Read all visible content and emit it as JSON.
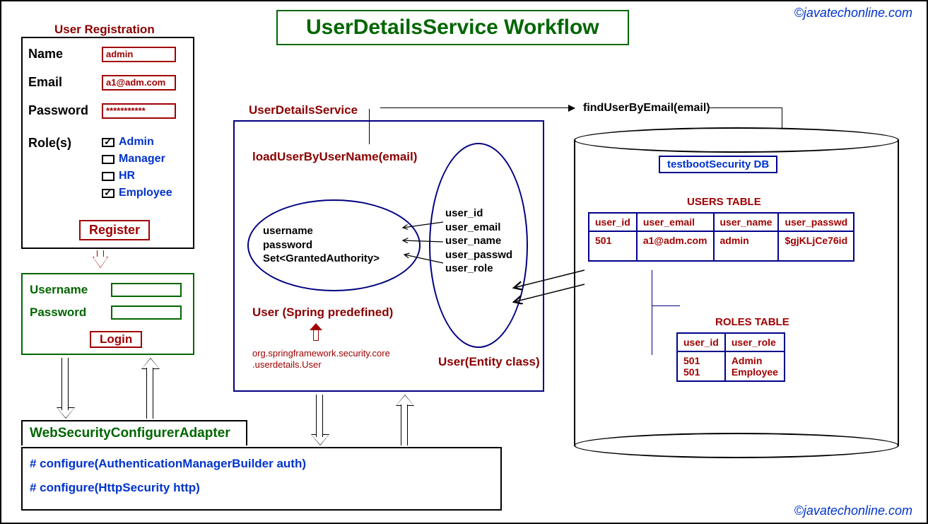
{
  "title": "UserDetailsService Workflow",
  "watermark": "©javatechonline.com",
  "registration": {
    "heading": "User Registration",
    "name_label": "Name",
    "name_value": "admin",
    "email_label": "Email",
    "email_value": "a1@adm.com",
    "password_label": "Password",
    "password_value": "***********",
    "roles_label": "Role(s)",
    "roles": [
      {
        "label": "Admin",
        "checked": true
      },
      {
        "label": "Manager",
        "checked": false
      },
      {
        "label": "HR",
        "checked": false
      },
      {
        "label": "Employee",
        "checked": true
      }
    ],
    "button": "Register"
  },
  "login": {
    "username_label": "Username",
    "password_label": "Password",
    "button": "Login"
  },
  "uds": {
    "title": "UserDetailsService",
    "method": "loadUserByUserName(email)",
    "spring_user_fields": "username\npassword\nSet<GrantedAuthority>",
    "entity_fields": "user_id\nuser_email\nuser_name\nuser_passwd\nuser_role",
    "spring_user_label": "User (Spring predefined)",
    "entity_label": "User(Entity class)",
    "package": "org.springframework.security.core\n.userdetails.User",
    "find_method": "findUserByEmail(email)"
  },
  "db": {
    "name": "testbootSecurity DB",
    "users_table_title": "USERS TABLE",
    "users_headers": {
      "c1": "user_id",
      "c2": "user_email",
      "c3": "user_name",
      "c4": "user_passwd"
    },
    "users_row": {
      "c1": "501",
      "c2": "a1@adm.com",
      "c3": "admin",
      "c4": "$gjKLjCe76id"
    },
    "roles_table_title": "ROLES TABLE",
    "roles_headers": {
      "c1": "user_id",
      "c2": "user_role"
    },
    "roles_row": {
      "c1": "501\n501",
      "c2": "Admin\nEmployee"
    }
  },
  "config": {
    "title": "WebSecurityConfigurerAdapter",
    "line1": "# configure(AuthenticationManagerBuilder auth)",
    "line2": "# configure(HttpSecurity http)"
  }
}
